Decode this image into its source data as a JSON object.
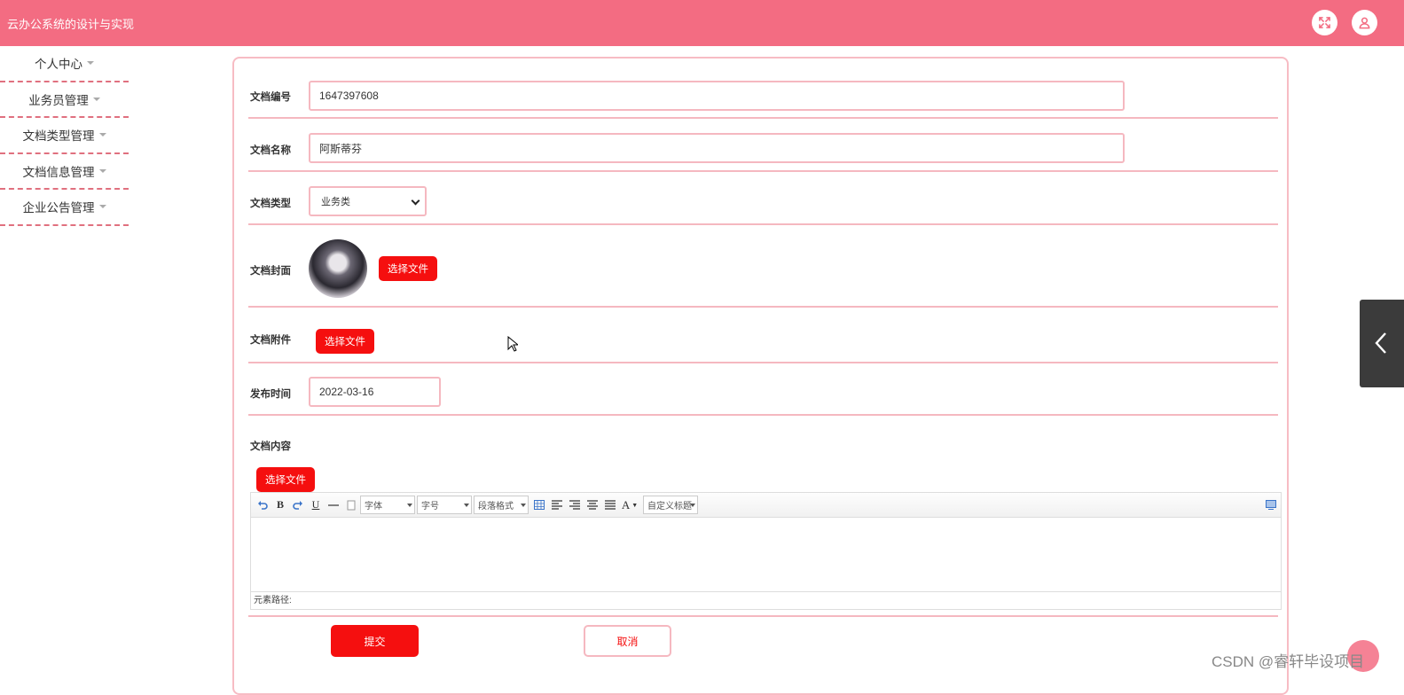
{
  "header": {
    "title": "云办公系统的设计与实现",
    "fullscreen_icon": "expand-icon",
    "user_icon": "user-icon"
  },
  "sidebar": {
    "items": [
      {
        "label": "个人中心"
      },
      {
        "label": "业务员管理"
      },
      {
        "label": "文档类型管理"
      },
      {
        "label": "文档信息管理"
      },
      {
        "label": "企业公告管理"
      }
    ]
  },
  "form": {
    "doc_no": {
      "label": "文档编号",
      "value": "1647397608"
    },
    "doc_name": {
      "label": "文档名称",
      "value": "阿斯蒂芬"
    },
    "doc_type": {
      "label": "文档类型",
      "value": "业务类"
    },
    "doc_cover": {
      "label": "文档封面",
      "button": "选择文件"
    },
    "doc_attachment": {
      "label": "文档附件",
      "button": "选择文件"
    },
    "publish_time": {
      "label": "发布时间",
      "value": "2022-03-16"
    },
    "doc_content": {
      "label": "文档内容",
      "button": "选择文件"
    },
    "submit_label": "提交",
    "cancel_label": "取消"
  },
  "editor": {
    "bold": "B",
    "underline": "U",
    "font_family": "字体",
    "font_size": "字号",
    "paragraph": "段落格式",
    "font_color": "A",
    "custom_title": "自定义标题",
    "status_path": "元素路径:"
  },
  "watermark": "CSDN @睿轩毕设项目",
  "colors": {
    "header": "#f36c82",
    "button_red": "#f50f0f",
    "border_pink": "#f5b8c0"
  }
}
